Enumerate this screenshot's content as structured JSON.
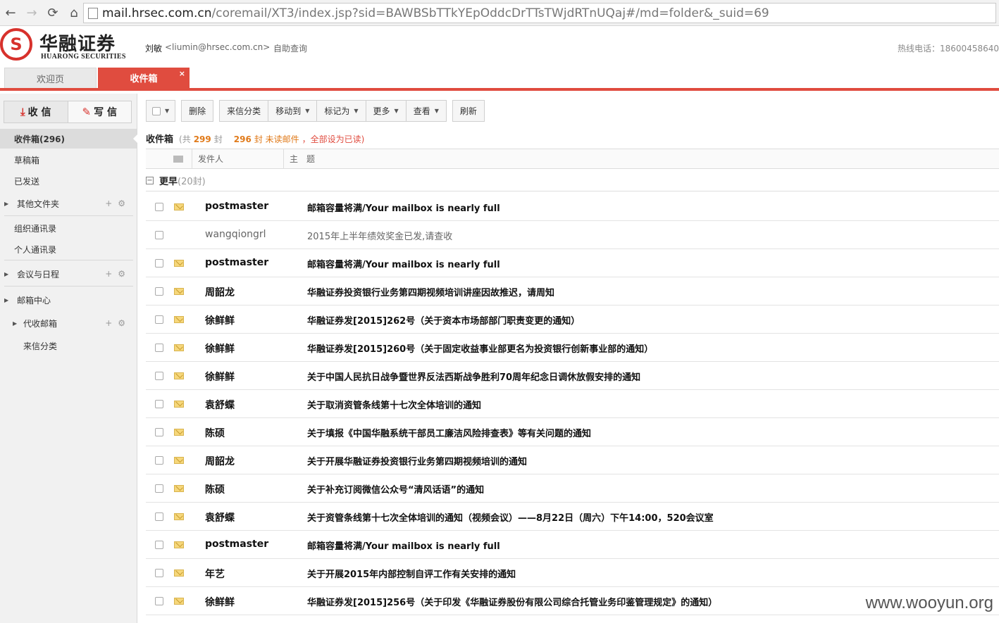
{
  "browser": {
    "url_host": "mail.hrsec.com.cn",
    "url_rest": "/coremail/XT3/index.jsp?sid=BAWBSbTTkYEpOddcDrTTsTWjdRTnUQaj#/md=folder&_suid=69"
  },
  "header": {
    "logo_cn": "华融证券",
    "logo_en": "HUARONG SECURITIES",
    "user_name": "刘敏",
    "user_email": "<liumin@hrsec.com.cn>",
    "self_query": "自助查询",
    "hotline": "热线电话：18600458640"
  },
  "tabs": [
    {
      "label": "欢迎页"
    },
    {
      "label": "收件箱",
      "close": "×"
    }
  ],
  "sidebar": {
    "receive_label": "收 信",
    "compose_label": "写 信",
    "items": [
      {
        "label": "收件箱(296)"
      },
      {
        "label": "草稿箱"
      },
      {
        "label": "已发送"
      },
      {
        "label": "其他文件夹"
      },
      {
        "label": "组织通讯录"
      },
      {
        "label": "个人通讯录"
      },
      {
        "label": "会议与日程"
      },
      {
        "label": "邮箱中心"
      },
      {
        "label": "代收邮箱"
      },
      {
        "label": "来信分类"
      }
    ]
  },
  "toolbar": {
    "delete": "删除",
    "classify": "来信分类",
    "move_to": "移动到",
    "mark_as": "标记为",
    "more": "更多",
    "view": "查看",
    "refresh": "刷新"
  },
  "summary": {
    "folder": "收件箱",
    "total_prefix": "(共",
    "total": "299",
    "total_suffix": "封",
    "unread": "296",
    "unread_suffix": "封 未读邮件",
    "mark_all": "，全部设为已读)"
  },
  "columns": {
    "sender": "发件人",
    "subject": "主　题"
  },
  "group": {
    "toggle": "−",
    "label": "更早",
    "count": "(20封)"
  },
  "mails": [
    {
      "sender": "postmaster",
      "subject": "邮箱容量将满/Your mailbox is nearly full",
      "unread": true
    },
    {
      "sender": "wangqiongrl",
      "subject": "2015年上半年绩效奖金已发,请查收",
      "unread": false
    },
    {
      "sender": "postmaster",
      "subject": "邮箱容量将满/Your mailbox is nearly full",
      "unread": true
    },
    {
      "sender": "周韶龙",
      "subject": "华融证券投资银行业务第四期视频培训讲座因故推迟，请周知",
      "unread": true
    },
    {
      "sender": "徐鲜鲜",
      "subject": "华融证券发[2015]262号（关于资本市场部部门职责变更的通知）",
      "unread": true
    },
    {
      "sender": "徐鲜鲜",
      "subject": "华融证券发[2015]260号（关于固定收益事业部更名为投资银行创新事业部的通知）",
      "unread": true
    },
    {
      "sender": "徐鲜鲜",
      "subject": "关于中国人民抗日战争暨世界反法西斯战争胜利70周年纪念日调休放假安排的通知",
      "unread": true
    },
    {
      "sender": "袁舒蝶",
      "subject": "关于取消资管条线第十七次全体培训的通知",
      "unread": true
    },
    {
      "sender": "陈硕",
      "subject": "关于填报《中国华融系统干部员工廉洁风险排查表》等有关问题的通知",
      "unread": true
    },
    {
      "sender": "周韶龙",
      "subject": "关于开展华融证券投资银行业务第四期视频培训的通知",
      "unread": true
    },
    {
      "sender": "陈硕",
      "subject": "关于补充订阅微信公众号“清风话语”的通知",
      "unread": true
    },
    {
      "sender": "袁舒蝶",
      "subject": "关于资管条线第十七次全体培训的通知（视频会议）——8月22日（周六）下午14:00，520会议室",
      "unread": true
    },
    {
      "sender": "postmaster",
      "subject": "邮箱容量将满/Your mailbox is nearly full",
      "unread": true
    },
    {
      "sender": "年艺",
      "subject": "关于开展2015年内部控制自评工作有关安排的通知",
      "unread": true
    },
    {
      "sender": "徐鲜鲜",
      "subject": "华融证券发[2015]256号（关于印发《华融证券股份有限公司综合托管业务印鉴管理规定》的通知）",
      "unread": true
    }
  ],
  "watermark": "www.wooyun.org"
}
